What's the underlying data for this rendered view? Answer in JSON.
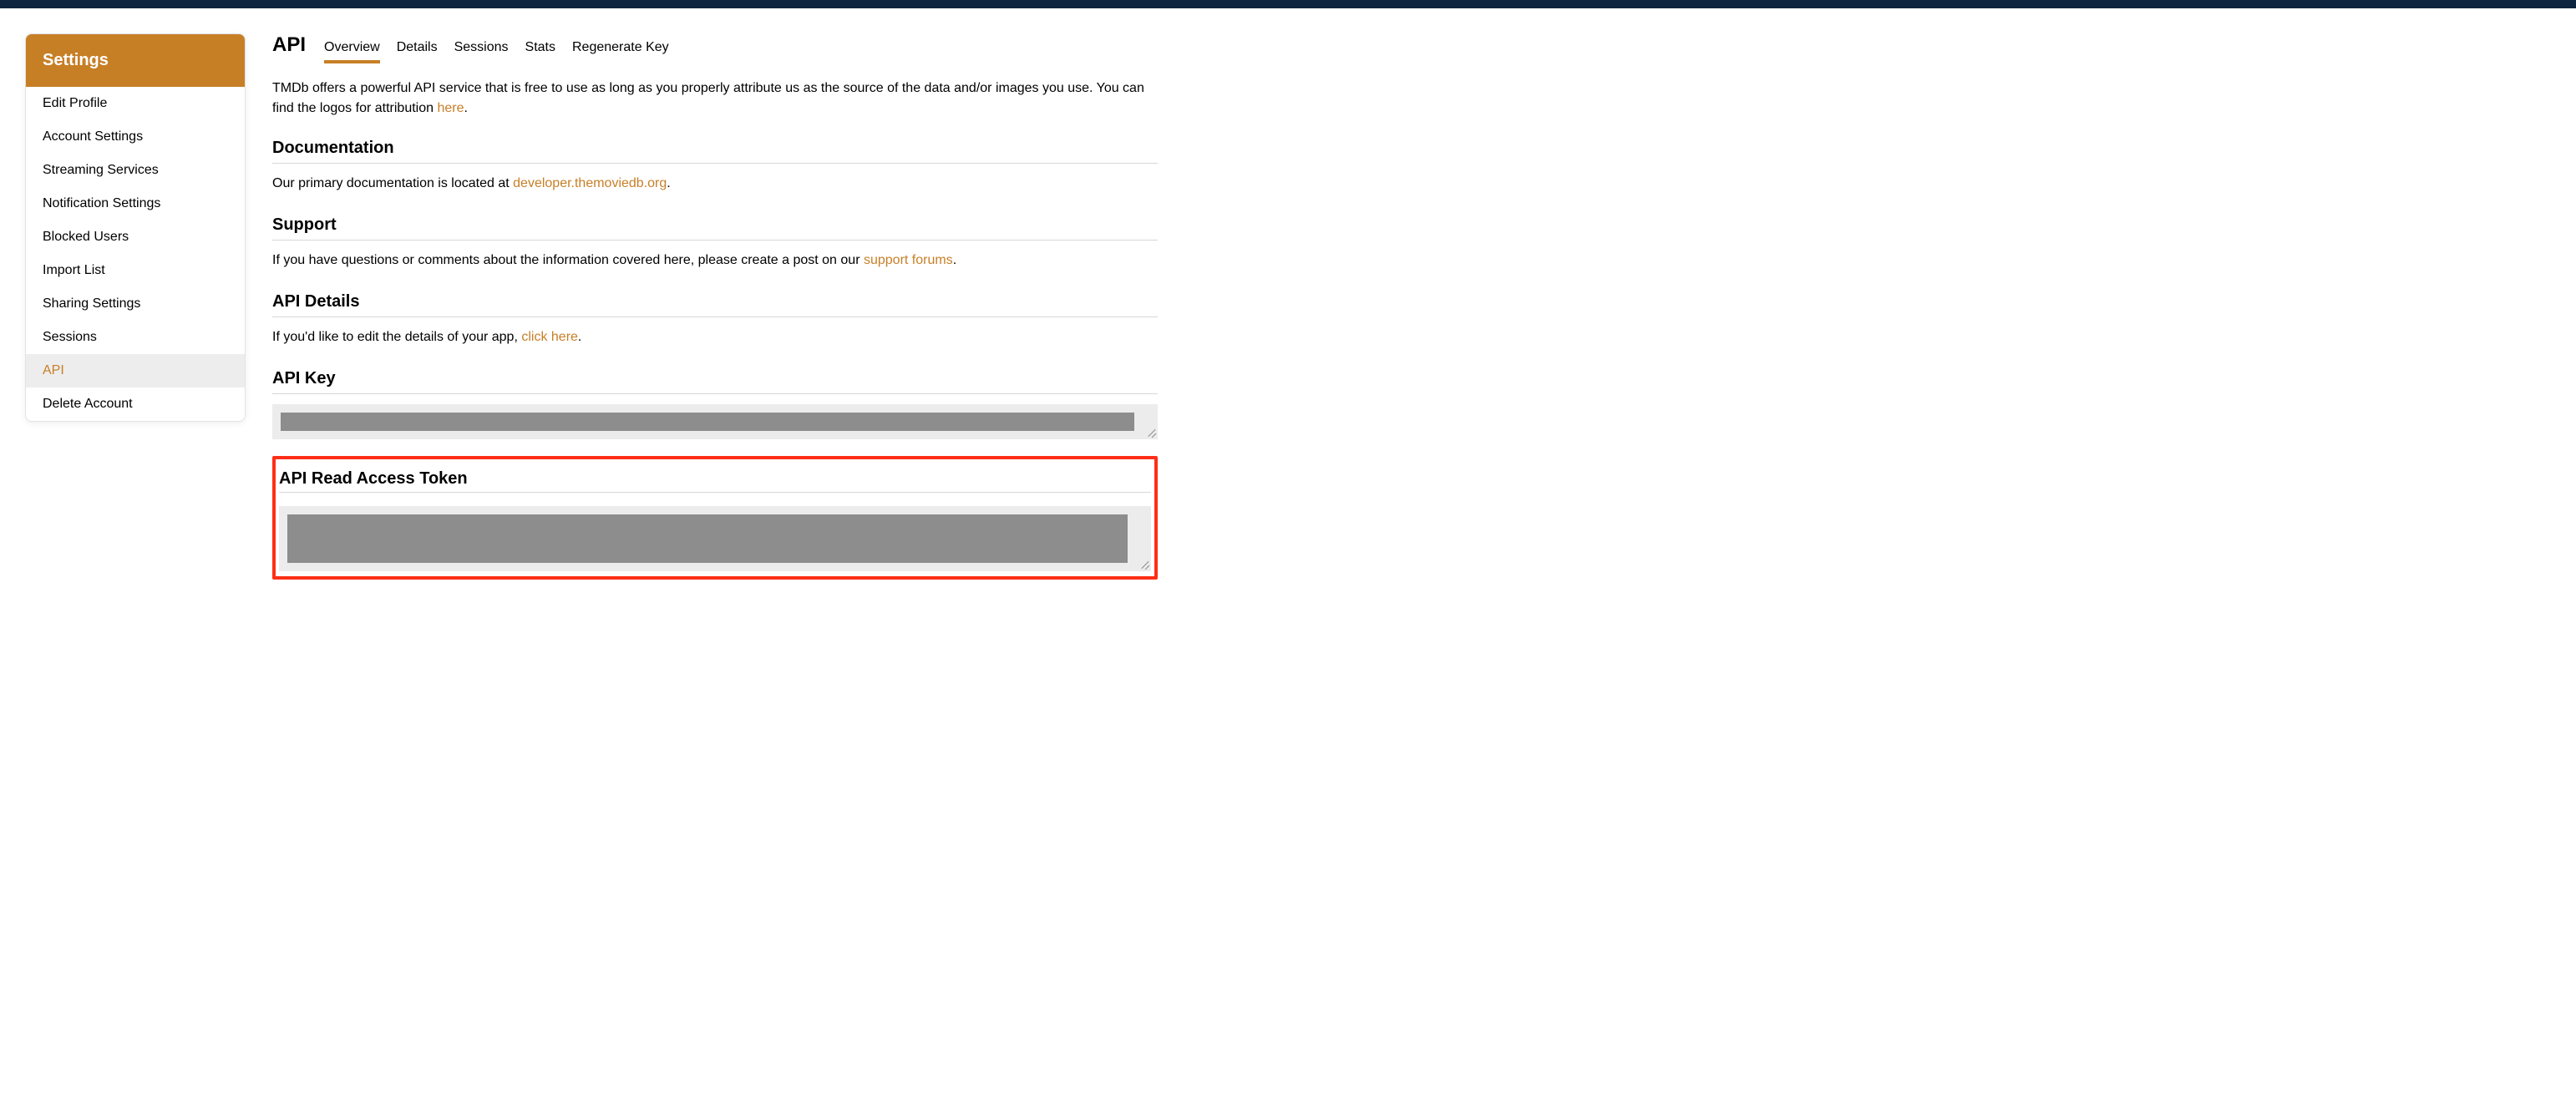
{
  "sidebar": {
    "title": "Settings",
    "items": [
      {
        "label": "Edit Profile"
      },
      {
        "label": "Account Settings"
      },
      {
        "label": "Streaming Services"
      },
      {
        "label": "Notification Settings"
      },
      {
        "label": "Blocked Users"
      },
      {
        "label": "Import List"
      },
      {
        "label": "Sharing Settings"
      },
      {
        "label": "Sessions"
      },
      {
        "label": "API"
      },
      {
        "label": "Delete Account"
      }
    ]
  },
  "header": {
    "title": "API",
    "tabs": [
      {
        "label": "Overview"
      },
      {
        "label": "Details"
      },
      {
        "label": "Sessions"
      },
      {
        "label": "Stats"
      },
      {
        "label": "Regenerate Key"
      }
    ]
  },
  "intro": {
    "text_before": "TMDb offers a powerful API service that is free to use as long as you properly attribute us as the source of the data and/or images you use. You can find the logos for attribution ",
    "link": "here",
    "text_after": "."
  },
  "sections": {
    "documentation": {
      "heading": "Documentation",
      "text_before": "Our primary documentation is located at ",
      "link": "developer.themoviedb.org",
      "text_after": "."
    },
    "support": {
      "heading": "Support",
      "text_before": "If you have questions or comments about the information covered here, please create a post on our ",
      "link": "support forums",
      "text_after": "."
    },
    "api_details": {
      "heading": "API Details",
      "text_before": "If you'd like to edit the details of your app, ",
      "link": "click here",
      "text_after": "."
    },
    "api_key": {
      "heading": "API Key"
    },
    "read_token": {
      "heading": "API Read Access Token"
    }
  }
}
